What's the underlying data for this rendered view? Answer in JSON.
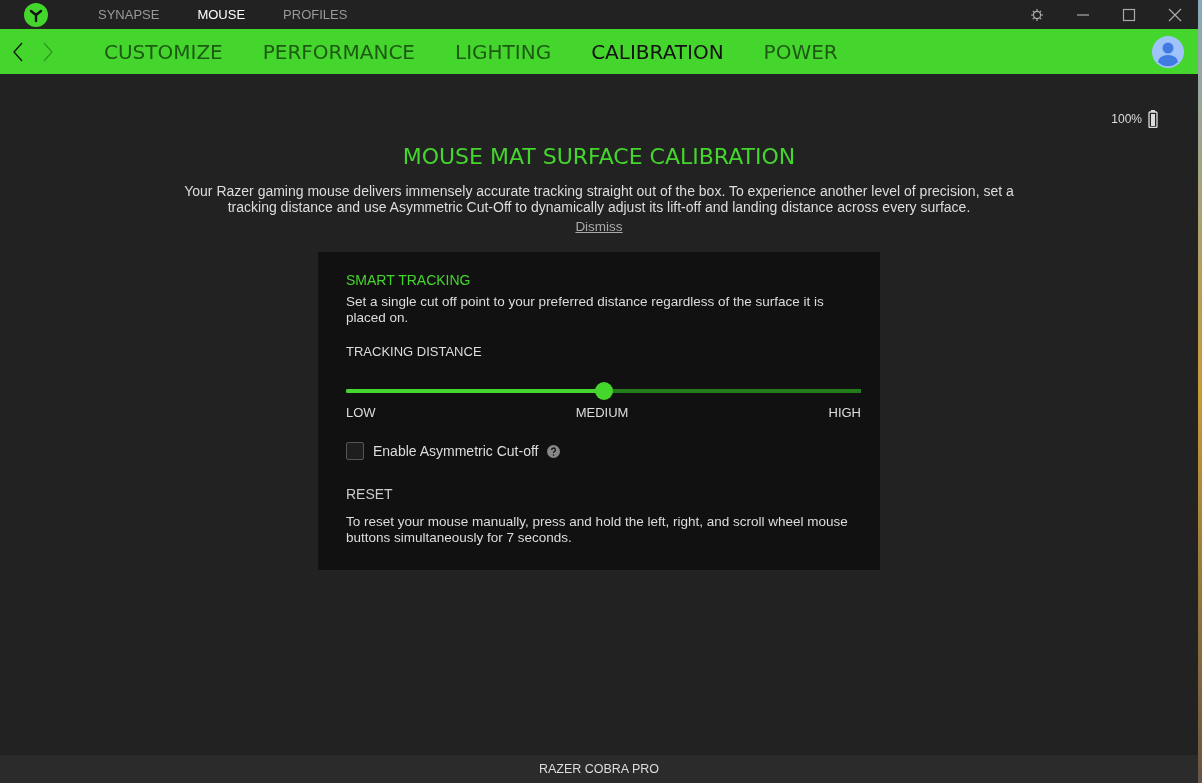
{
  "top_tabs": [
    {
      "label": "SYNAPSE",
      "selected": false
    },
    {
      "label": "MOUSE",
      "selected": true
    },
    {
      "label": "PROFILES",
      "selected": false
    }
  ],
  "nav": {
    "back": {
      "disabled": false
    },
    "forward": {
      "disabled": true
    }
  },
  "sub_tabs": [
    {
      "label": "CUSTOMIZE",
      "selected": false
    },
    {
      "label": "PERFORMANCE",
      "selected": false
    },
    {
      "label": "LIGHTING",
      "selected": false
    },
    {
      "label": "CALIBRATION",
      "selected": true
    },
    {
      "label": "POWER",
      "selected": false
    }
  ],
  "battery": {
    "reading": "100%"
  },
  "intro": {
    "title": "MOUSE MAT SURFACE CALIBRATION",
    "text": "Your Razer gaming mouse delivers immensely accurate tracking straight out of the box. To experience another level of precision, set a tracking distance and use Asymmetric Cut-Off to dynamically adjust its lift-off and landing distance across every surface.",
    "link": "Dismiss"
  },
  "smart_tracking": {
    "title": "SMART TRACKING",
    "description": "Set a single cut off point to your preferred distance regardless of the surface it is placed on.",
    "slider_label": "TRACKING DISTANCE",
    "slider": {
      "level": 0.5
    },
    "ticks": [
      "LOW",
      "MEDIUM",
      "HIGH"
    ],
    "asymmetric": {
      "label": "Enable Asymmetric Cut-off",
      "checked": false
    }
  },
  "reset": {
    "title": "RESET",
    "text": "To reset your mouse manually, press and hold the left, right, and scroll wheel mouse buttons simultaneously for 7 seconds."
  },
  "status_bar": {
    "device": "RAZER COBRA PRO"
  }
}
